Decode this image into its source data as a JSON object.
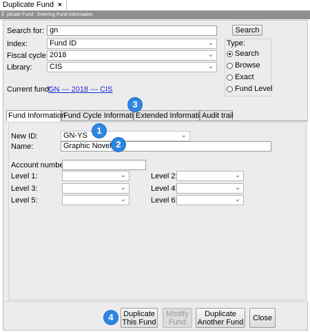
{
  "window": {
    "tab_title": "Duplicate Fund",
    "close_glyph": "×",
    "subtitle_lead": "F",
    "subtitle": "plicate Fund :  Entering Fund Information"
  },
  "search": {
    "search_for_label": "Search for:",
    "search_value": "gn",
    "search_button": "Search",
    "index_label": "Index:",
    "index_value": "Fund ID",
    "fiscal_label": "Fiscal cycle:",
    "fiscal_value": "2018",
    "library_label": "Library:",
    "library_value": "CIS"
  },
  "type": {
    "label": "Type:",
    "options": [
      {
        "label": "Search",
        "selected": true
      },
      {
        "label": "Browse",
        "selected": false
      },
      {
        "label": "Exact",
        "selected": false
      },
      {
        "label": "Fund Level",
        "selected": false
      }
    ]
  },
  "current_fund": {
    "label": "Current fund:",
    "value": "GN --- 2018 --- CIS"
  },
  "tabs": [
    "Fund Information",
    "Fund Cycle Information",
    "Extended Information",
    "Audit trail"
  ],
  "form": {
    "new_id_label": "New ID:",
    "new_id_value": "GN-YS",
    "name_label": "Name:",
    "name_value": "Graphic Novels",
    "account_label": "Account number:",
    "account_value": "",
    "levels": [
      "Level 1:",
      "Level 2:",
      "Level 3:",
      "Level 4:",
      "Level 5:",
      "Level 6:"
    ]
  },
  "badges": [
    "1",
    "2",
    "3",
    "4"
  ],
  "buttons": {
    "duplicate_this_1": "Duplicate",
    "duplicate_this_2": "This Fund",
    "modify_1": "Modify",
    "modify_2": "Fund",
    "duplicate_another_1": "Duplicate",
    "duplicate_another_2": "Another Fund",
    "close": "Close"
  },
  "colors": {
    "badge": "#2f86e0",
    "link": "#1a28d8",
    "panel": "#ececec",
    "subtitle_bar": "#8f8f8f"
  }
}
